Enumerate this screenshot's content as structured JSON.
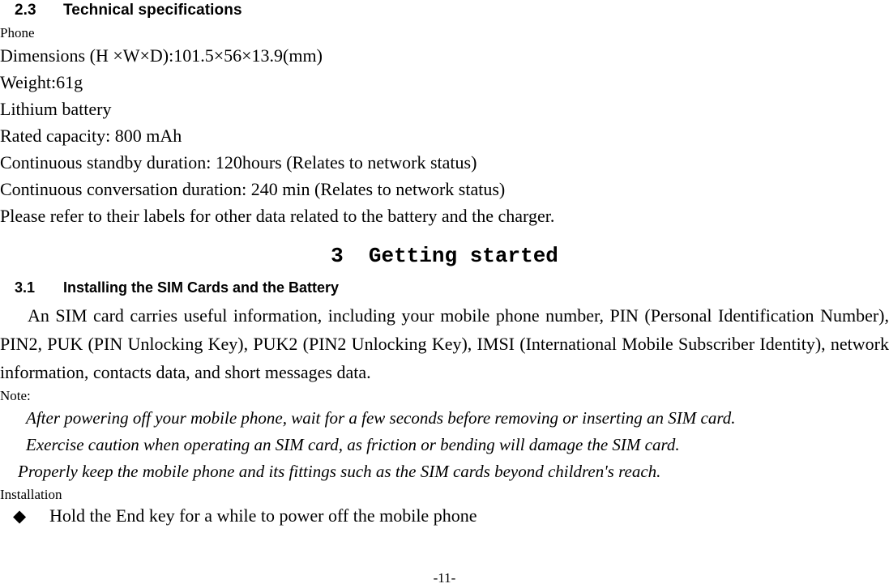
{
  "document": {
    "page_number": "-11-"
  },
  "section_2_3": {
    "number": "2.3",
    "title": "Technical specifications",
    "group_label": "Phone",
    "spec_lines": [
      "Dimensions (H ×W×D):101.5×56×13.9(mm)",
      "Weight:61g",
      "Lithium battery",
      "Rated capacity: 800 mAh",
      "Continuous standby duration: 120hours (Relates to network status)",
      "Continuous conversation duration: 240 min (Relates to network status)",
      "Please refer to their labels for other data related to the battery and the charger."
    ]
  },
  "chapter_3": {
    "number": "3",
    "title": "Getting started",
    "heading_text": "3  Getting started"
  },
  "section_3_1": {
    "number": "3.1",
    "title": "Installing the SIM Cards and the Battery",
    "paragraph": "An SIM card carries useful information, including your mobile phone number, PIN (Personal Identification Number), PIN2, PUK (PIN Unlocking Key), PUK2 (PIN2 Unlocking Key), IMSI (International Mobile Subscriber Identity), network information, contacts data, and short messages data.",
    "note_label": "Note:",
    "note_lines": [
      "After powering off your mobile phone, wait for a few seconds before removing or inserting an SIM card.",
      "Exercise caution when operating an SIM card, as friction or bending will damage the SIM card.",
      "Properly keep the mobile phone and its fittings such as the SIM cards beyond children's reach."
    ],
    "installation_label": "Installation",
    "installation_steps": [
      {
        "bullet": "◆",
        "text": "Hold the End key for a while to power off the mobile phone"
      }
    ]
  }
}
